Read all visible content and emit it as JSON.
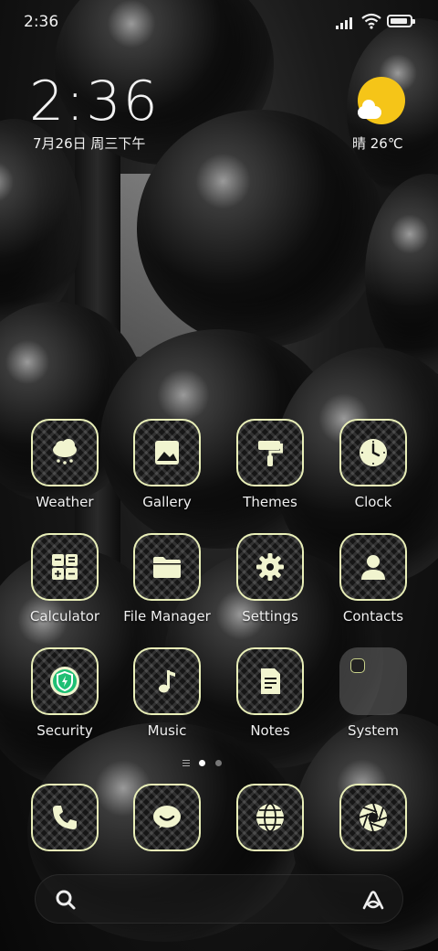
{
  "status_bar": {
    "time": "2:36"
  },
  "clock_widget": {
    "time": "2:36",
    "date": "7月26日 周三下午"
  },
  "weather_widget": {
    "text": "晴 26℃",
    "icon": "sun-cloud-icon",
    "sun_color": "#f5c518"
  },
  "apps": [
    {
      "label": "Weather",
      "icon": "weather-icon"
    },
    {
      "label": "Gallery",
      "icon": "gallery-icon"
    },
    {
      "label": "Themes",
      "icon": "themes-icon"
    },
    {
      "label": "Clock",
      "icon": "clock-icon"
    },
    {
      "label": "Calculator",
      "icon": "calculator-icon"
    },
    {
      "label": "File Manager",
      "icon": "folder-icon"
    },
    {
      "label": "Settings",
      "icon": "gear-icon"
    },
    {
      "label": "Contacts",
      "icon": "person-icon"
    },
    {
      "label": "Security",
      "icon": "shield-icon"
    },
    {
      "label": "Music",
      "icon": "music-note-icon"
    },
    {
      "label": "Notes",
      "icon": "note-icon"
    },
    {
      "label": "System",
      "icon": "folder-icon"
    }
  ],
  "dock": [
    {
      "icon": "phone-icon"
    },
    {
      "icon": "message-icon"
    },
    {
      "icon": "globe-icon"
    },
    {
      "icon": "camera-aperture-icon"
    }
  ],
  "pager": {
    "pages": 2,
    "active": 1
  },
  "search_bar": {
    "left_icon": "search-icon",
    "right_icon": "assistant-icon"
  },
  "colors": {
    "icon_tint": "#e9efb8",
    "security_green": "#1fbf74"
  }
}
